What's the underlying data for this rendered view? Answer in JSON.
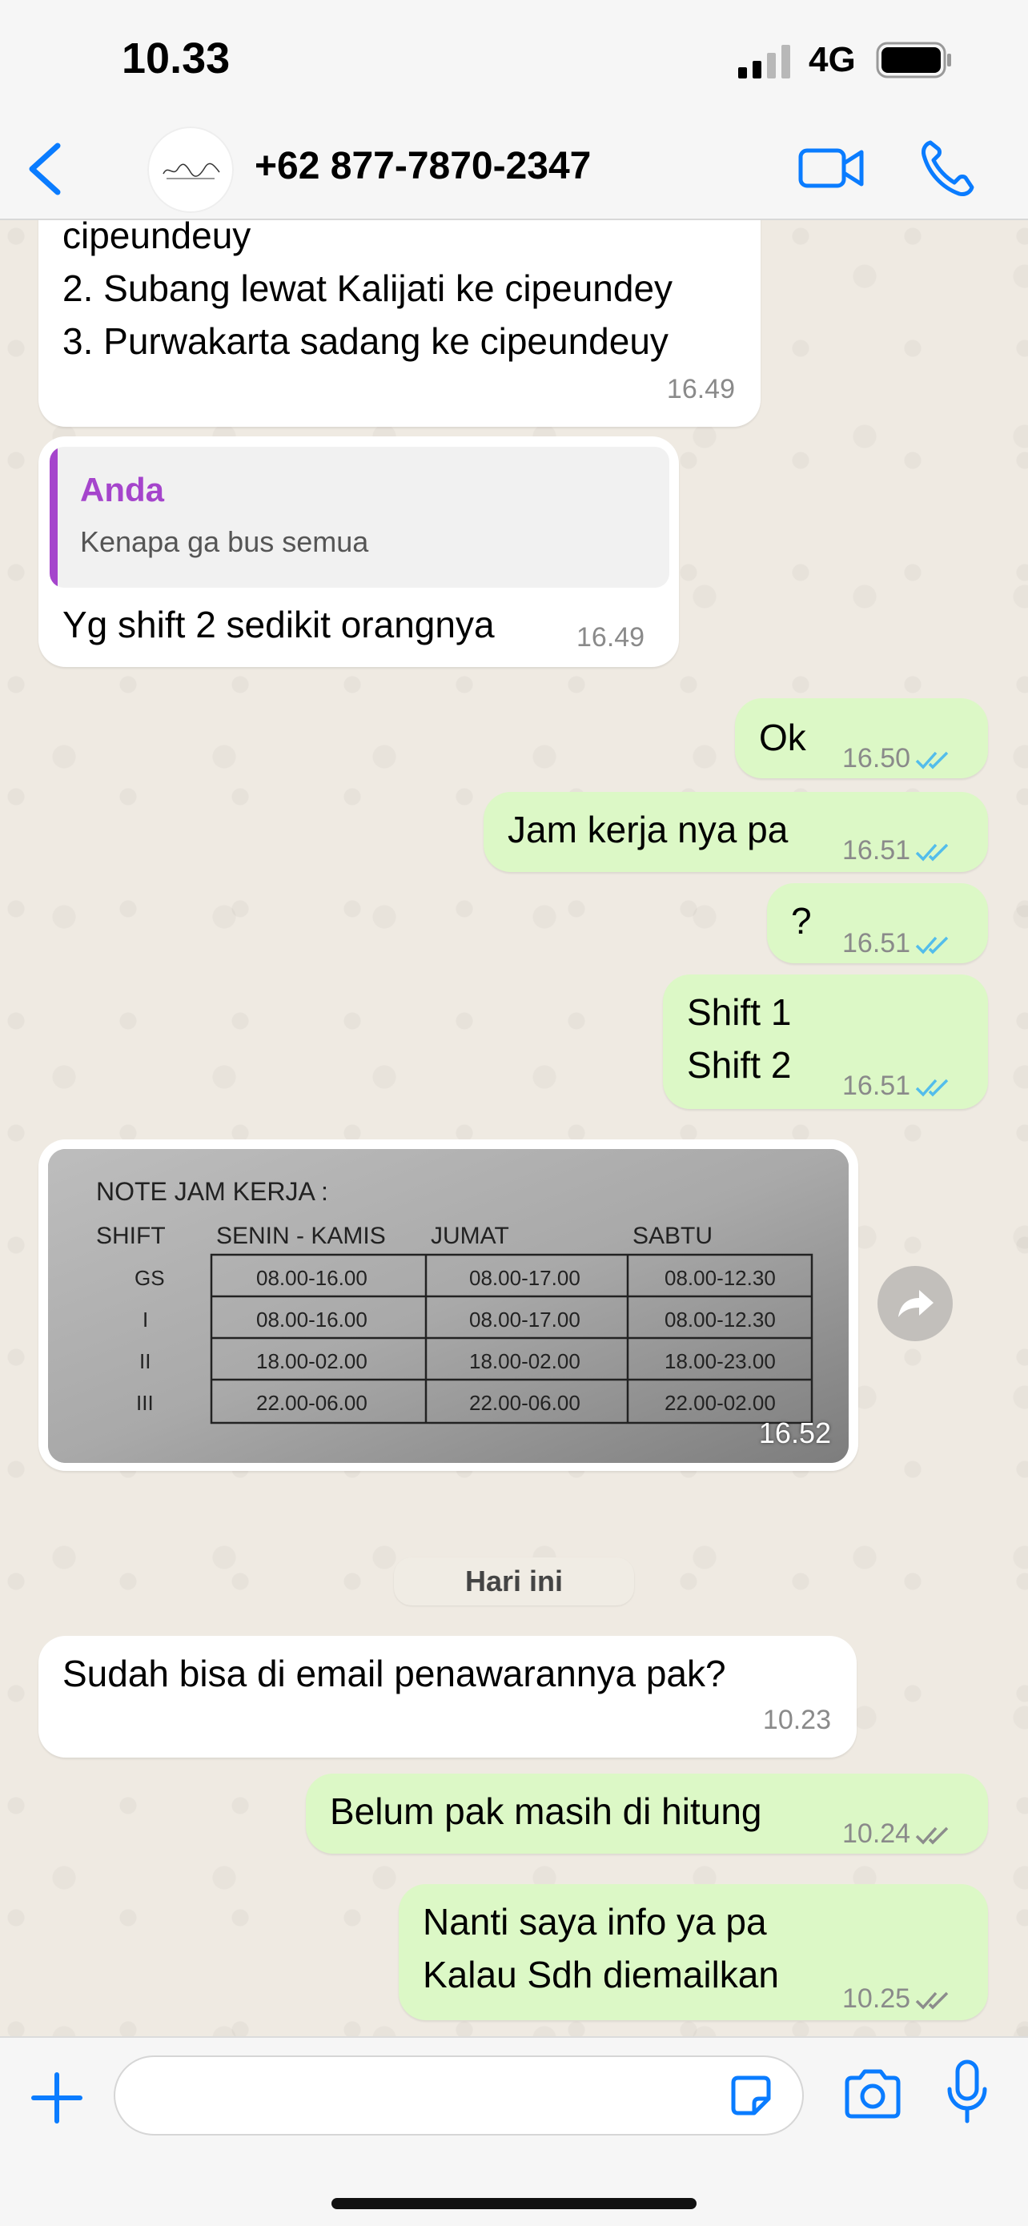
{
  "status_bar": {
    "time": "10.33",
    "network": "4G"
  },
  "header": {
    "contact": "+62 877-7870-2347"
  },
  "messages": {
    "m1": {
      "line1": "cipeundeuy",
      "line2": "2. Subang lewat Kalijati ke cipeundey",
      "line3": "3. Purwakarta sadang ke cipeundeuy",
      "time": "16.49"
    },
    "m2": {
      "quote_author": "Anda",
      "quote_text": "Kenapa ga bus semua",
      "text": "Yg shift 2 sedikit orangnya",
      "time": "16.49"
    },
    "m3": {
      "text": "Ok",
      "time": "16.50"
    },
    "m4": {
      "text": "Jam kerja nya pa",
      "time": "16.51"
    },
    "m5": {
      "text": "?",
      "time": "16.51"
    },
    "m6": {
      "line1": "Shift 1",
      "line2": "Shift 2",
      "time": "16.51"
    },
    "m7": {
      "time": "16.52",
      "photo": {
        "title": "NOTE JAM KERJA :",
        "headers": [
          "SHIFT",
          "SENIN - KAMIS",
          "JUMAT",
          "SABTU"
        ],
        "rows": [
          [
            "GS",
            "08.00-16.00",
            "08.00-17.00",
            "08.00-12.30"
          ],
          [
            "I",
            "08.00-16.00",
            "08.00-17.00",
            "08.00-12.30"
          ],
          [
            "II",
            "18.00-02.00",
            "18.00-02.00",
            "18.00-23.00"
          ],
          [
            "III",
            "22.00-06.00",
            "22.00-06.00",
            "22.00-02.00"
          ]
        ]
      }
    },
    "date_separator": "Hari ini",
    "m8": {
      "text": "Sudah bisa di email penawarannya pak?",
      "time": "10.23"
    },
    "m9": {
      "text": "Belum pak masih di hitung",
      "time": "10.24"
    },
    "m10": {
      "line1": "Nanti saya info ya pa",
      "line2": "Kalau Sdh diemailkan",
      "time": "10.25"
    }
  },
  "colors": {
    "read_ticks": "#53bdeb",
    "delivered_ticks": "#8c8c8c",
    "accent": "#0a7cff",
    "outgoing_bubble": "#dcf8c6"
  }
}
